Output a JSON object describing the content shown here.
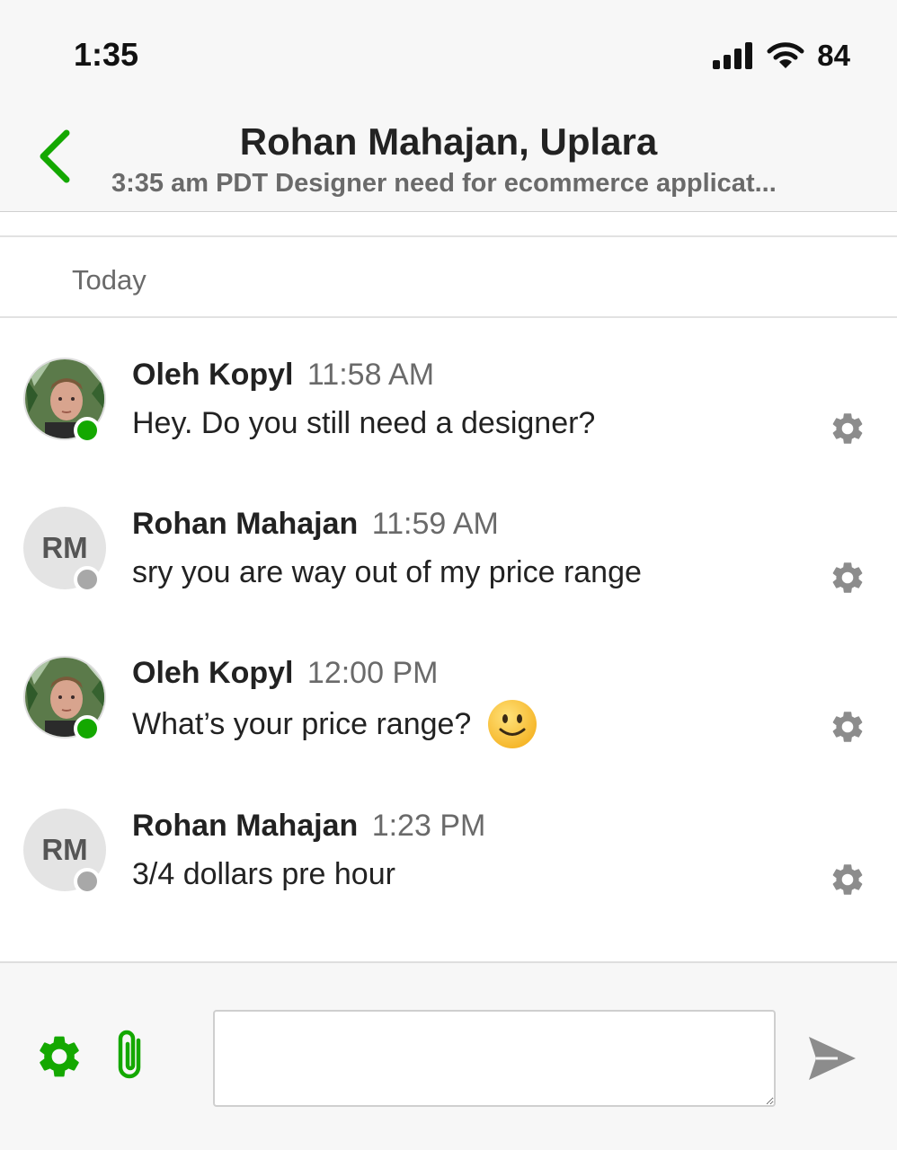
{
  "status_bar": {
    "time": "1:35",
    "battery": "84"
  },
  "header": {
    "title": "Rohan Mahajan, Uplara",
    "subtitle": "3:35 am PDT Designer need for ecommerce applicat..."
  },
  "day_label": "Today",
  "messages": [
    {
      "sender": "Oleh Kopyl",
      "time": "11:58 AM",
      "text": "Hey. Do you still need a designer?",
      "avatar_type": "photo",
      "presence": "online"
    },
    {
      "sender": "Rohan Mahajan",
      "time": "11:59 AM",
      "text": "sry you are way out of my price range",
      "avatar_type": "initials",
      "initials": "RM",
      "presence": "offline"
    },
    {
      "sender": "Oleh Kopyl",
      "time": "12:00 PM",
      "text": "What’s your price range?",
      "emoji": "slightly-smiling-face",
      "avatar_type": "photo",
      "presence": "online"
    },
    {
      "sender": "Rohan Mahajan",
      "time": "1:23 PM",
      "text": "3/4 dollars pre hour",
      "avatar_type": "initials",
      "initials": "RM",
      "presence": "offline"
    }
  ],
  "composer": {
    "input_value": "",
    "placeholder": ""
  },
  "colors": {
    "accent_green": "#14a800",
    "online": "#14a800",
    "offline": "#a8a8a8",
    "muted_icon": "#8c8c8c"
  },
  "icons": {
    "back": "chevron-left-icon",
    "signal": "signal-icon",
    "wifi": "wifi-icon",
    "message_settings": "gear-icon",
    "composer_settings": "gear-icon",
    "attach": "paperclip-icon",
    "send": "send-icon"
  }
}
